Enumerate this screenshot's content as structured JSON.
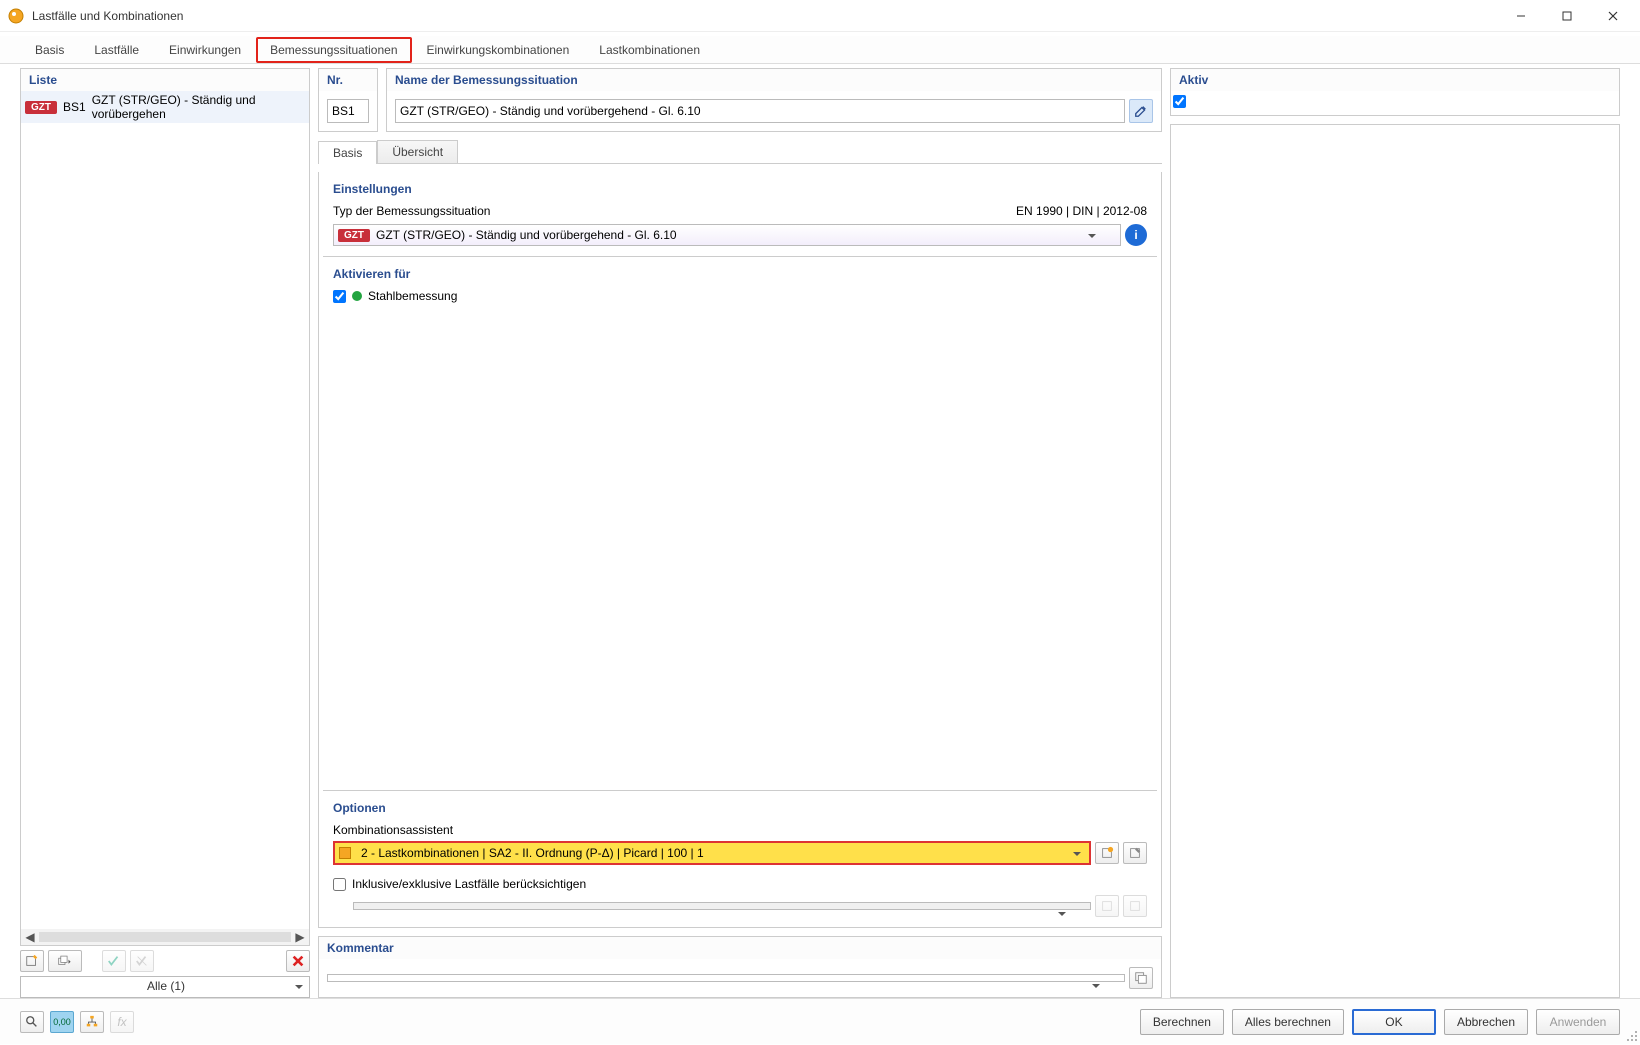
{
  "window": {
    "title": "Lastfälle und Kombinationen"
  },
  "tabs": {
    "basis": "Basis",
    "lastfaelle": "Lastfälle",
    "einwirkungen": "Einwirkungen",
    "bemessungssituationen": "Bemessungssituationen",
    "einwirkungskombinationen": "Einwirkungskombinationen",
    "lastkombinationen": "Lastkombinationen"
  },
  "left": {
    "header": "Liste",
    "items": [
      {
        "badge": "GZT",
        "code": "BS1",
        "text": "GZT (STR/GEO) - Ständig und vorübergehen"
      }
    ],
    "filter": "Alle (1)"
  },
  "top": {
    "nr_label": "Nr.",
    "nr_value": "BS1",
    "name_label": "Name der Bemessungssituation",
    "name_value": "GZT (STR/GEO) - Ständig und vorübergehend - Gl. 6.10",
    "aktiv_label": "Aktiv"
  },
  "subtabs": {
    "basis": "Basis",
    "uebersicht": "Übersicht"
  },
  "einstellungen": {
    "title": "Einstellungen",
    "typ_label": "Typ der Bemessungssituation",
    "norm": "EN 1990 | DIN | 2012-08",
    "typ_badge": "GZT",
    "typ_value": "GZT (STR/GEO) - Ständig und vorübergehend - Gl. 6.10"
  },
  "aktivieren": {
    "title": "Aktivieren für",
    "stahlbemessung": "Stahlbemessung"
  },
  "optionen": {
    "title": "Optionen",
    "assistent_label": "Kombinationsassistent",
    "assistent_value": "2 - Lastkombinationen | SA2 - II. Ordnung (P-Δ) | Picard | 100 | 1",
    "inklusive": "Inklusive/exklusive Lastfälle berücksichtigen"
  },
  "kommentar": {
    "title": "Kommentar"
  },
  "buttons": {
    "berechnen": "Berechnen",
    "alles_berechnen": "Alles berechnen",
    "ok": "OK",
    "abbrechen": "Abbrechen",
    "anwenden": "Anwenden"
  }
}
